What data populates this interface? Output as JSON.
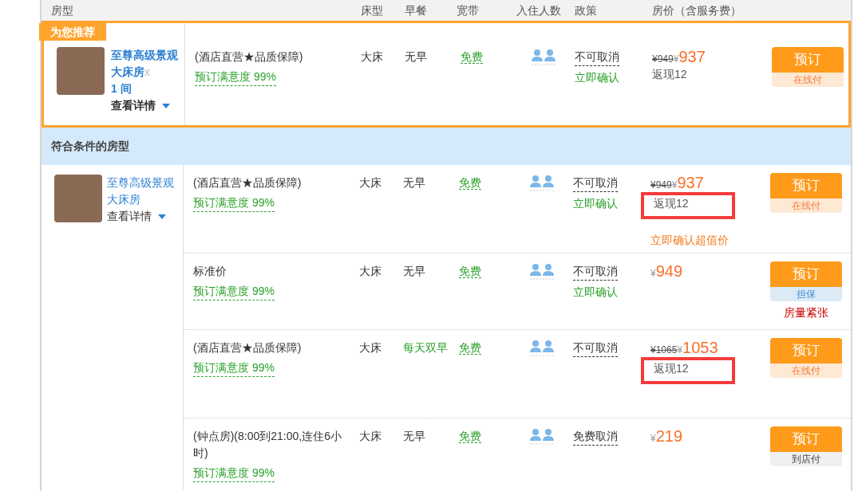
{
  "header": {
    "columns": [
      "房型",
      "床型",
      "早餐",
      "宽带",
      "入住人数",
      "政策",
      "房价（含服务费）"
    ]
  },
  "recommended": {
    "badge": "为您推荐",
    "room": {
      "name": "至尊高级景观大床房",
      "remove": "x",
      "quantity": "1",
      "unit": "间",
      "details": "查看详情"
    },
    "rate": {
      "title": "(酒店直营★品质保障)",
      "satisfaction": "预订满意度 99%",
      "bed": "大床",
      "breakfast": "无早",
      "breakfast_highlight": false,
      "wifi": "免费",
      "policy": "不可取消",
      "confirm": "立即确认",
      "original_price": "¥949",
      "currency": "¥",
      "price": "937",
      "cashback": "返现12",
      "highlighted": false,
      "button": "预订",
      "pay": "在线付",
      "kind": "online"
    }
  },
  "section_title": "符合条件的房型",
  "room_group": {
    "name": "至尊高级景观大床房",
    "details": "查看详情",
    "rates": [
      {
        "title": "(酒店直营★品质保障)",
        "satisfaction": "预订满意度 99%",
        "bed": "大床",
        "breakfast": "无早",
        "breakfast_highlight": false,
        "wifi": "免费",
        "policy": "不可取消",
        "confirm": "立即确认",
        "original_price": "¥949",
        "currency": "¥",
        "price": "937",
        "cashback": "返现12",
        "highlighted": true,
        "promo": "立即确认超值价",
        "button": "预订",
        "pay": "在线付",
        "kind": "online"
      },
      {
        "title": "标准价",
        "satisfaction": "预订满意度 99%",
        "bed": "大床",
        "breakfast": "无早",
        "breakfast_highlight": false,
        "wifi": "免费",
        "policy": "不可取消",
        "confirm": "立即确认",
        "currency": "¥",
        "price": "949",
        "button": "预订",
        "pay": "担保",
        "kind": "guarantee",
        "stock_note": "房量紧张"
      },
      {
        "title": "(酒店直营★品质保障)",
        "satisfaction": "预订满意度 99%",
        "bed": "大床",
        "breakfast": "每天双早",
        "breakfast_highlight": true,
        "wifi": "免费",
        "policy": "不可取消",
        "original_price": "¥1065",
        "currency": "¥",
        "price": "1053",
        "cashback": "返现12",
        "highlighted": true,
        "button": "预订",
        "pay": "在线付",
        "kind": "online"
      },
      {
        "title": "(钟点房)(8:00到21:00,连住6小时)",
        "satisfaction": "预订满意度 99%",
        "bed": "大床",
        "breakfast": "无早",
        "breakfast_highlight": false,
        "wifi": "免费",
        "policy": "免费取消",
        "currency": "¥",
        "price": "219",
        "button": "预订",
        "pay": "到店付",
        "kind": "store"
      }
    ]
  }
}
